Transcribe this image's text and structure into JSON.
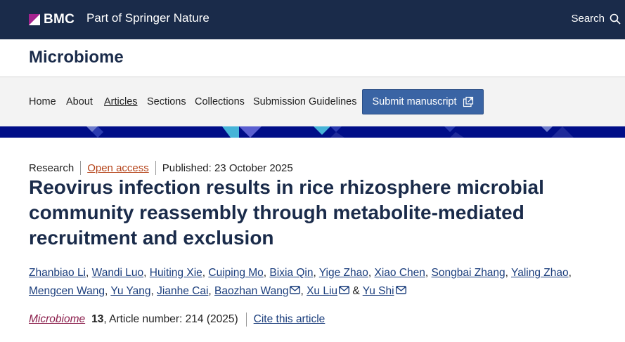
{
  "header": {
    "brand": "BMC",
    "tagline": "Part of Springer Nature",
    "search_label": "Search",
    "background_color": "#1a2b4a",
    "logo_accent_color": "#a4238f"
  },
  "journal": {
    "name": "Microbiome"
  },
  "nav": {
    "items": [
      {
        "label": "Home"
      },
      {
        "label": "About"
      },
      {
        "label": "Articles",
        "active": true
      },
      {
        "label": "Sections"
      },
      {
        "label": "Collections"
      },
      {
        "label": "Submission Guidelines"
      }
    ],
    "submit_label": "Submit manuscript",
    "submit_color": "#3a64a4"
  },
  "article": {
    "type": "Research",
    "access": "Open access",
    "published": "Published: 23 October 2025",
    "title": "Reovirus infection results in rice rhizosphere microbial community reassembly through metabolite-mediated recruitment and exclusion",
    "authors": [
      {
        "name": "Zhanbiao Li"
      },
      {
        "name": "Wandi Luo"
      },
      {
        "name": "Huiting Xie"
      },
      {
        "name": "Cuiping Mo"
      },
      {
        "name": "Bixia Qin"
      },
      {
        "name": "Yige Zhao"
      },
      {
        "name": "Xiao Chen"
      },
      {
        "name": "Songbai Zhang"
      },
      {
        "name": "Yaling Zhao"
      },
      {
        "name": "Mengcen Wang"
      },
      {
        "name": "Yu Yang"
      },
      {
        "name": "Jianhe Cai"
      },
      {
        "name": "Baozhan Wang",
        "contact": true
      },
      {
        "name": "Xu Liu",
        "contact": true
      },
      {
        "name": "Yu Shi",
        "contact": true
      }
    ],
    "and_separator": "&",
    "citation": {
      "journal": "Microbiome",
      "volume": "13",
      "article_number": ", Article number: 214 (2025)",
      "cite_label": "Cite this article"
    }
  }
}
